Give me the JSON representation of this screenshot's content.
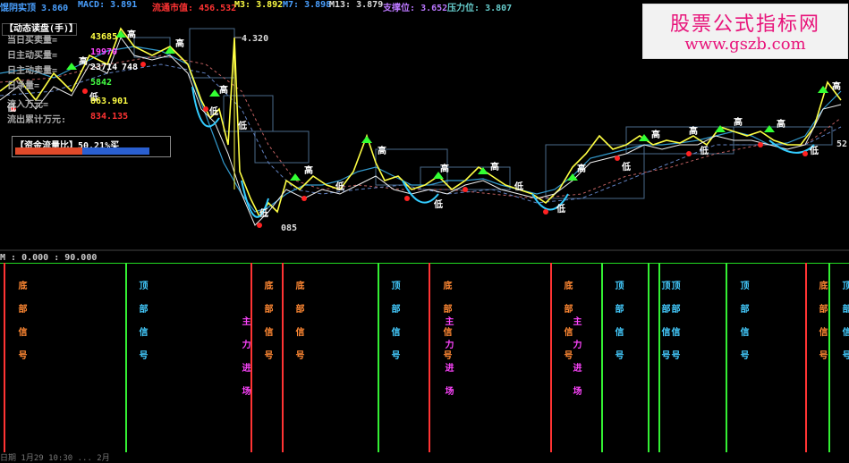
{
  "header": {
    "items": [
      {
        "label": "馄阴实顶",
        "value": "3.860",
        "color": "#4aa0ff"
      },
      {
        "label": "MACD:",
        "value": "3.891",
        "color": "#4aa0ff"
      },
      {
        "label": "流通市值:",
        "value": "456.532",
        "color": "#ff3333"
      },
      {
        "label": "M3:",
        "value": "3.892",
        "color": "#ffff44"
      },
      {
        "label": "M7:",
        "value": "3.898",
        "color": "#4aa0ff"
      },
      {
        "label": "M13:",
        "value": "3.879",
        "color": "#dddddd"
      },
      {
        "label": "支撑位:",
        "value": "3.652",
        "color": "#bb77ff"
      },
      {
        "label": "压力位:",
        "value": "3.807",
        "color": "#66cccc"
      }
    ]
  },
  "panel": {
    "title": "【动态读盘(手)】",
    "rows": [
      {
        "label": "当日买卖量=",
        "value": "43685",
        "color": "#ffff44"
      },
      {
        "label": "日主动买量=",
        "value": "19970",
        "color": "#ff44ff"
      },
      {
        "label": "日主动卖量=",
        "value": "23714",
        "color": "#ffffff"
      },
      {
        "label": "日净量=",
        "value": "5842",
        "color": "#44ff44"
      },
      {
        "label": "流入万元=",
        "value": "863.901",
        "color": "#ffff44"
      },
      {
        "label": "流出累计万元:",
        "value": "834.135",
        "color": "#ff3333"
      }
    ]
  },
  "flow": {
    "label": "【资金流量比】50.21%买",
    "buy_ratio": 0.5021
  },
  "chart_labels": {
    "top_price": "4.320",
    "bottom_price": "085",
    "high_mark": "高",
    "low_mark": "低",
    "right_price": "52",
    "mid_price": "748"
  },
  "watermark": {
    "line1": "股票公式指标网",
    "line2": "www.gszb.com"
  },
  "sub_header": "M : 0.000 : 90.000",
  "signals": {
    "bottom": "底部信号",
    "top": "顶部信号",
    "main": "主力进场"
  },
  "footer": "日期 1月29 10:30 ... 2月"
}
